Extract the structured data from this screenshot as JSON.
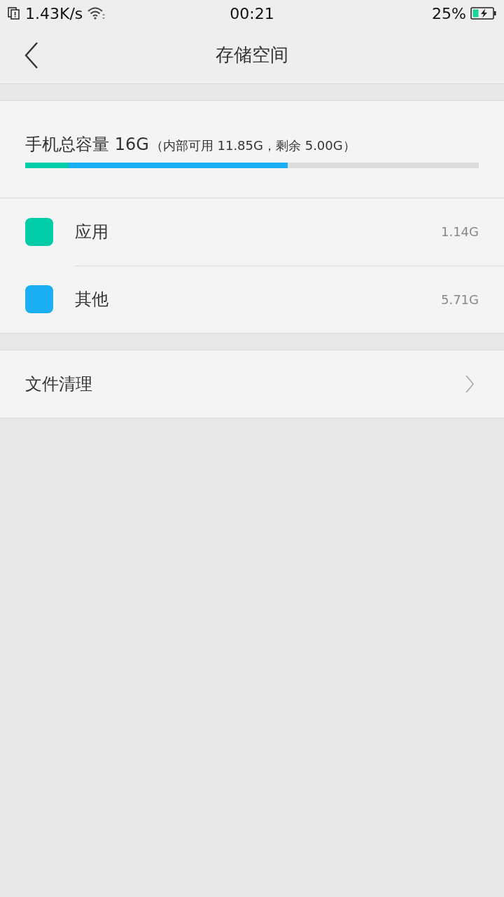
{
  "status_bar": {
    "network_speed": "1.43K/s",
    "time": "00:21",
    "battery": "25%"
  },
  "header": {
    "title": "存储空间"
  },
  "capacity": {
    "label": "手机总容量 16G",
    "detail": "（内部可用 11.85G，剩余 5.00G）"
  },
  "categories": [
    {
      "name": "应用",
      "size": "1.14G",
      "color": "#00cca8",
      "level": 0.096
    },
    {
      "name": "其他",
      "size": "5.71G",
      "color": "#1aaef2",
      "level": 0.579
    }
  ],
  "actions": [
    {
      "label": "文件清理"
    }
  ]
}
